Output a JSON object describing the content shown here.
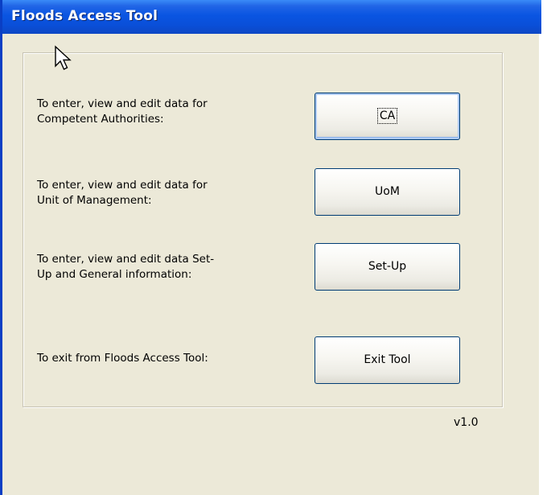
{
  "window": {
    "title": "Floods Access Tool"
  },
  "rows": [
    {
      "line1": "To enter, view and edit data for",
      "line2": "Competent Authorities:",
      "button": "CA"
    },
    {
      "line1": "To enter, view and edit data for",
      "line2": "Unit of Management:",
      "button": "UoM"
    },
    {
      "line1": "To enter, view and edit data Set-",
      "line2": "Up and General information:",
      "button": "Set-Up"
    },
    {
      "line1": "To exit from Floods Access Tool:",
      "button": "Exit Tool"
    }
  ],
  "footer": {
    "version": "v1.0"
  },
  "icons": {
    "cursor": "mouse-pointer-icon"
  }
}
